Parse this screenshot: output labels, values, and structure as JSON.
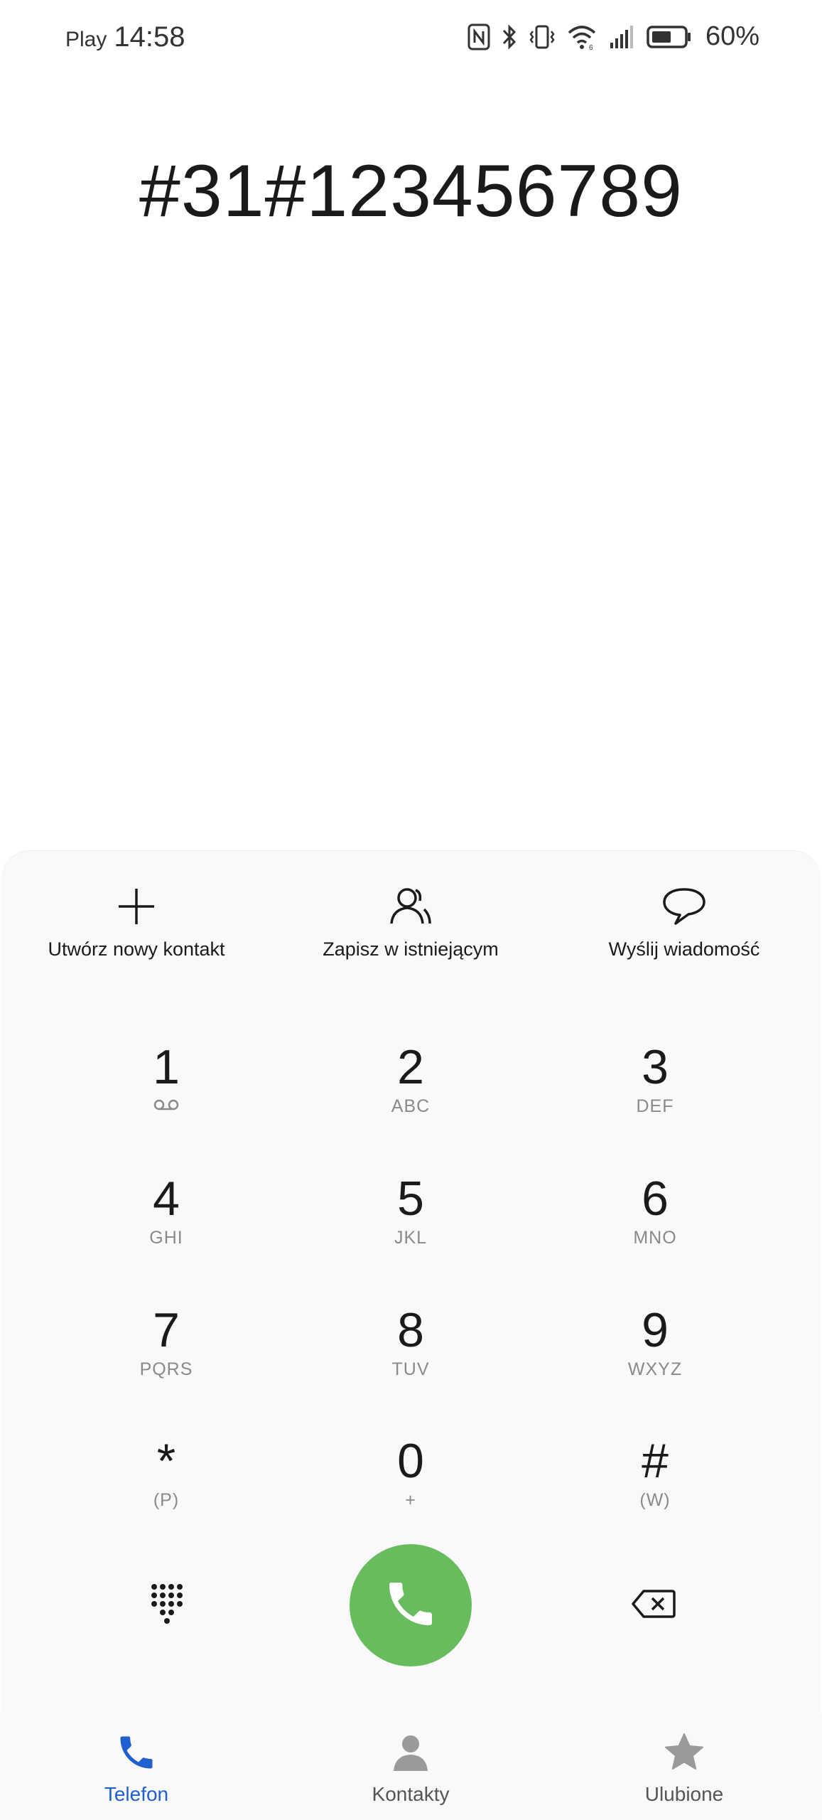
{
  "status_bar": {
    "carrier": "Play",
    "time": "14:58",
    "battery_percent": "60%",
    "icons": [
      "nfc-icon",
      "bluetooth-icon",
      "vibrate-icon",
      "wifi-icon",
      "signal-icon",
      "battery-icon"
    ]
  },
  "dialer": {
    "number": "#31#123456789"
  },
  "actions": [
    {
      "label": "Utwórz nowy kontakt",
      "icon": "plus-icon"
    },
    {
      "label": "Zapisz w istniejącym",
      "icon": "contact-icon"
    },
    {
      "label": "Wyślij wiadomość",
      "icon": "message-icon"
    }
  ],
  "keypad": [
    {
      "digit": "1",
      "sub": "",
      "sub_icon": "voicemail-icon"
    },
    {
      "digit": "2",
      "sub": "ABC"
    },
    {
      "digit": "3",
      "sub": "DEF"
    },
    {
      "digit": "4",
      "sub": "GHI"
    },
    {
      "digit": "5",
      "sub": "JKL"
    },
    {
      "digit": "6",
      "sub": "MNO"
    },
    {
      "digit": "7",
      "sub": "PQRS"
    },
    {
      "digit": "8",
      "sub": "TUV"
    },
    {
      "digit": "9",
      "sub": "WXYZ"
    },
    {
      "digit": "*",
      "sub": "(P)"
    },
    {
      "digit": "0",
      "sub": "+"
    },
    {
      "digit": "#",
      "sub": "(W)"
    }
  ],
  "nav": [
    {
      "label": "Telefon",
      "icon": "phone-icon",
      "active": true
    },
    {
      "label": "Kontakty",
      "icon": "person-icon",
      "active": false
    },
    {
      "label": "Ulubione",
      "icon": "star-icon",
      "active": false
    }
  ],
  "colors": {
    "call_button": "#67bd5e",
    "active_nav": "#1f5fcf",
    "panel_bg": "#f9f9f9"
  }
}
